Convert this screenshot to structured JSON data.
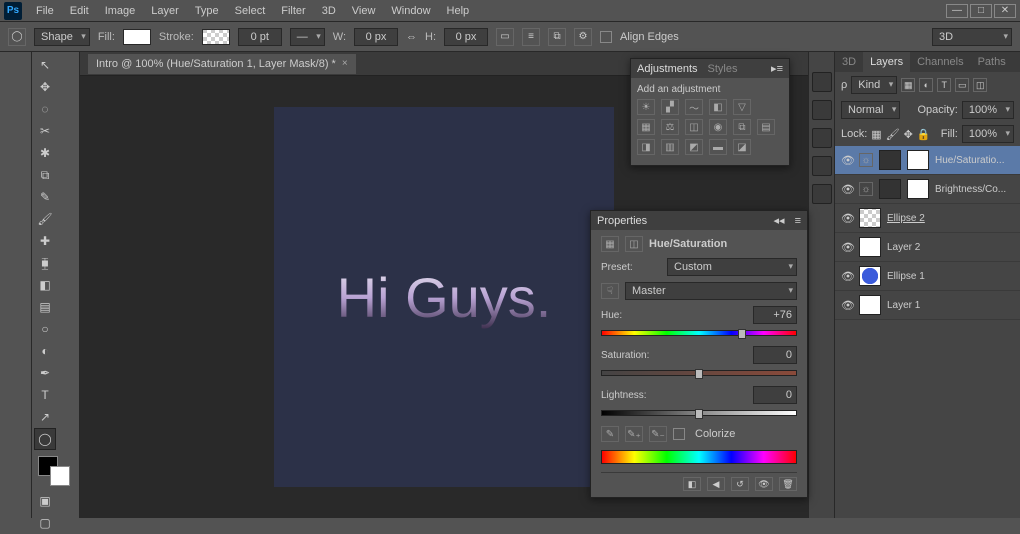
{
  "menu": {
    "items": [
      "File",
      "Edit",
      "Image",
      "Layer",
      "Type",
      "Select",
      "Filter",
      "3D",
      "View",
      "Window",
      "Help"
    ]
  },
  "optbar": {
    "shape_label": "Shape",
    "fill_label": "Fill:",
    "stroke_label": "Stroke:",
    "stroke_val": "0 pt",
    "w_label": "W:",
    "w_val": "0 px",
    "h_label": "H:",
    "h_val": "0 px",
    "align_label": "Align Edges",
    "mode_label": "3D"
  },
  "tab_title": "Intro @ 100% (Hue/Saturation 1, Layer Mask/8) *",
  "canvas_text": "Hi Guys.",
  "adjustments": {
    "tab1": "Adjustments",
    "tab2": "Styles",
    "add_label": "Add an adjustment"
  },
  "properties": {
    "title": "Properties",
    "panel_label": "Hue/Saturation",
    "preset_label": "Preset:",
    "preset_val": "Custom",
    "channel_val": "Master",
    "hue_label": "Hue:",
    "hue_val": "+76",
    "sat_label": "Saturation:",
    "sat_val": "0",
    "light_label": "Lightness:",
    "light_val": "0",
    "colorize_label": "Colorize"
  },
  "layers_panel": {
    "tabs": [
      "3D",
      "Layers",
      "Channels",
      "Paths"
    ],
    "kind": "Kind",
    "blend": "Normal",
    "opacity_label": "Opacity:",
    "opacity_val": "100%",
    "lock_label": "Lock:",
    "fill_label": "Fill:",
    "fill_val": "100%",
    "layers": [
      {
        "name": "Hue/Saturatio...",
        "sel": true,
        "adj": true
      },
      {
        "name": "Brightness/Co...",
        "sel": false,
        "adj": true
      },
      {
        "name": "Ellipse 2",
        "sel": false,
        "underline": true,
        "trans": true
      },
      {
        "name": "Layer 2",
        "sel": false
      },
      {
        "name": "Ellipse 1",
        "sel": false,
        "blue": true
      },
      {
        "name": "Layer 1",
        "sel": false
      }
    ]
  }
}
